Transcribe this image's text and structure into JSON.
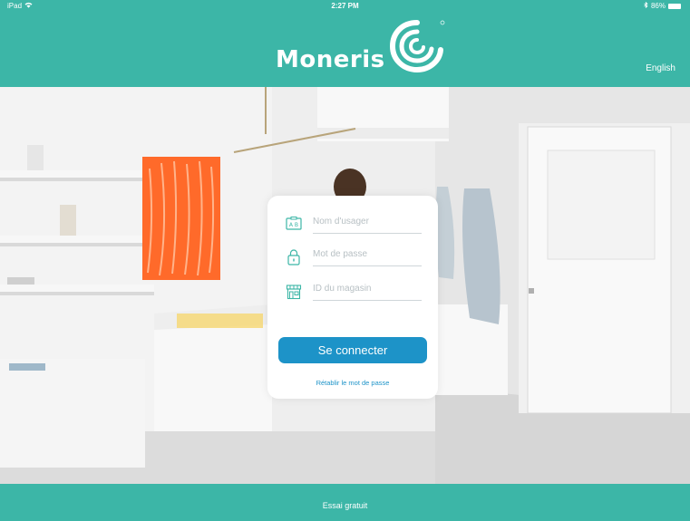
{
  "status_bar": {
    "device": "iPad",
    "time": "2:27 PM",
    "battery": "86%"
  },
  "header": {
    "brand": "Moneris",
    "language": "English",
    "icons": {
      "wifi": "wifi-icon",
      "bluetooth": "bluetooth-icon",
      "battery": "battery-icon",
      "logo": "moneris-swirl-icon"
    }
  },
  "login": {
    "username_placeholder": "Nom d'usager",
    "password_placeholder": "Mot de passe",
    "store_id_placeholder": "ID du magasin",
    "submit_label": "Se connecter",
    "reset_link": "Rétablir le mot de passe",
    "icons": {
      "username": "id-card-icon",
      "password": "padlock-icon",
      "store": "storefront-icon"
    }
  },
  "footer": {
    "trial_label": "Essai gratuit"
  },
  "colors": {
    "brand_teal": "#3cb6a7",
    "button_blue": "#1d93c8"
  }
}
